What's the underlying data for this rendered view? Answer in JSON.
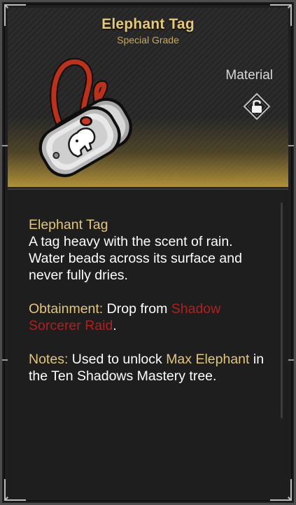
{
  "item": {
    "name": "Elephant Tag",
    "grade": "Special Grade",
    "category": "Material",
    "lock_icon": "lock-icon"
  },
  "description": {
    "heading": "Elephant Tag",
    "flavor": "A tag heavy with the scent of rain. Water beads across its surface and never fully dries."
  },
  "obtainment": {
    "label": "Obtainment:",
    "prefix": " Drop from ",
    "source": "Shadow Sorcerer Raid",
    "suffix": "."
  },
  "notes": {
    "label": "Notes:",
    "prefix": " Used to unlock ",
    "unlock": "Max Elephant",
    "suffix": " in the Ten Shadows Mastery tree."
  },
  "colors": {
    "title_gold": "#e7c97a",
    "accent_gold": "#e3c57d",
    "source_red": "#b31f1f",
    "cord_red": "#b8321e"
  }
}
